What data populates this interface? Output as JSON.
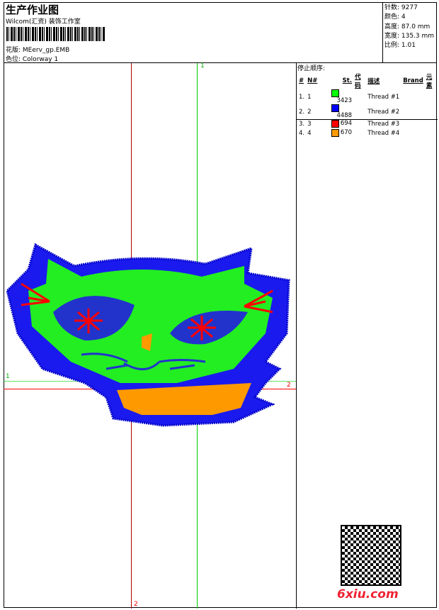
{
  "header": {
    "title": "生产作业图",
    "company": "Wilcom(汇资) 装饰工作室",
    "design": "花版:  MEerv_gp.EMB",
    "colorway": "色位:  Colorway 1"
  },
  "info": [
    "针数: 9277",
    "颜色: 4",
    "高度: 87.0 mm",
    "宽度: 135.3 mm",
    "比例: 1.01"
  ],
  "stop": {
    "title": "停止顺序:",
    "columns": [
      "#",
      "N#",
      "St.",
      "代码",
      "描述",
      "Brand",
      "元素"
    ],
    "rows": [
      {
        "idx": "1.",
        "n": "1",
        "color": "#00ff00",
        "st": "3423",
        "desc": "Thread #1"
      },
      {
        "idx": "2.",
        "n": "2",
        "color": "#0000ff",
        "st": "4488",
        "desc": "Thread #2"
      },
      {
        "idx": "3.",
        "n": "3",
        "color": "#ff0000",
        "st": "694",
        "desc": "Thread #3"
      },
      {
        "idx": "4.",
        "n": "4",
        "color": "#ff9900",
        "st": "670",
        "desc": "Thread #4"
      }
    ]
  },
  "axes": {
    "v1": "1",
    "h1": "1",
    "h2": "2",
    "v2": "2"
  },
  "watermark": "6xiu.com"
}
